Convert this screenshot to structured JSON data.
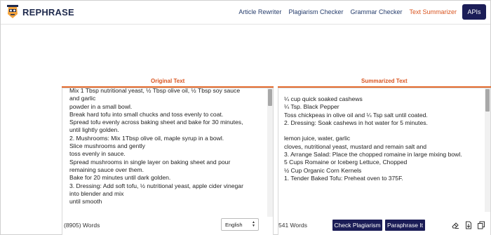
{
  "brand": {
    "name": "REPHRASE"
  },
  "nav": {
    "links": [
      {
        "label": "Article Rewriter"
      },
      {
        "label": "Plagiarism Checker"
      },
      {
        "label": "Grammar Checker"
      },
      {
        "label": "Text Summarizer"
      }
    ],
    "active": "Text Summarizer",
    "api_label": "APIs"
  },
  "left_panel": {
    "title": "Original Text",
    "lines": [
      "Mix 1 Tbsp nutritional yeast, ½ Tbsp olive oil, ½ Tbsp soy sauce",
      "and garlic",
      " powder in a small bowl.",
      " Break hard tofu into small chucks and toss evenly to coat.",
      " Spread tofu evenly across baking sheet and bake for 30 minutes,",
      "until lightly golden.",
      " 2. Mushrooms: Mix 1Tbsp olive oil, maple syrup in a bowl.",
      " Slice mushrooms and gently",
      " toss evenly in sauce.",
      " Spread mushrooms in single layer on baking sheet and pour",
      " remaining sauce over them.",
      " Bake for 20 minutes until dark golden.",
      " 3. Dressing: Add soft tofu, ½ nutritional yeast, apple cider vinegar",
      "into blender and mix",
      " until smooth"
    ],
    "word_count": "(8905) Words",
    "language": "English"
  },
  "right_panel": {
    "title": "Summarized Text",
    "lines": [
      "¼ cup quick soaked cashews",
      "¼ Tsp. Black Pepper",
      "Toss chickpeas in olive oil and ¼ Tsp salt until coated.",
      "2. Dressing: Soak cashews in hot water for 5 minutes.",
      "",
      "lemon juice, water, garlic",
      "cloves, nutritional yeast, mustard and remain salt and",
      "3. Arrange Salad: Place the chopped romaine in large mixing bowl.",
      "5 Cups Romaine or Iceberg Lettuce, Chopped",
      "½ Cup Organic Corn Kernels",
      "1. Tender Baked Tofu: Preheat oven to 375F."
    ],
    "word_count": "541 Words",
    "check_plagiarism_label": "Check Plagiarism",
    "paraphrase_label": "Paraphrase It"
  },
  "colors": {
    "accent": "#d9541f",
    "navy": "#1b1d57",
    "nav_text": "#253c6b"
  },
  "icons": [
    "robot-logo-icon",
    "eraser-icon",
    "download-icon",
    "copy-icon",
    "select-arrows-icon"
  ]
}
